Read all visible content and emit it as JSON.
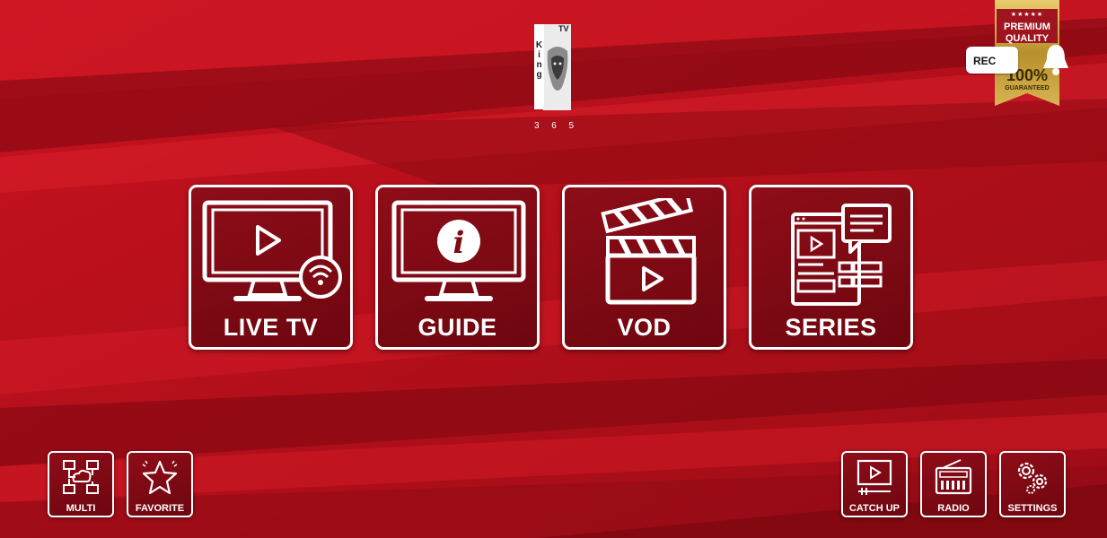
{
  "logo": {
    "word": "King",
    "tv": "TV",
    "digits": [
      "3",
      "6",
      "5"
    ]
  },
  "badge": {
    "stars": "★★★★★",
    "line1": "PREMIUM",
    "line2": "QUALITY",
    "percent": "100%",
    "guarantee": "GUARANTEED"
  },
  "record_label": "REC",
  "main_menu": [
    {
      "label": "LIVE TV",
      "icon": "live-tv-icon"
    },
    {
      "label": "GUIDE",
      "icon": "tv-info-icon"
    },
    {
      "label": "VOD",
      "icon": "clapperboard-icon"
    },
    {
      "label": "SERIES",
      "icon": "series-layout-icon"
    }
  ],
  "bottom_left": [
    {
      "label": "MULTI",
      "icon": "network-cloud-icon"
    },
    {
      "label": "FAVORITE",
      "icon": "star-icon"
    }
  ],
  "bottom_right": [
    {
      "label": "CATCH UP",
      "icon": "catchup-player-icon"
    },
    {
      "label": "RADIO",
      "icon": "radio-icon"
    },
    {
      "label": "SETTINGS",
      "icon": "gears-icon"
    }
  ],
  "colors": {
    "background": "#b3111c",
    "tile": "#7e0a14",
    "border": "#ffffff",
    "gold": "#c9a23a"
  }
}
